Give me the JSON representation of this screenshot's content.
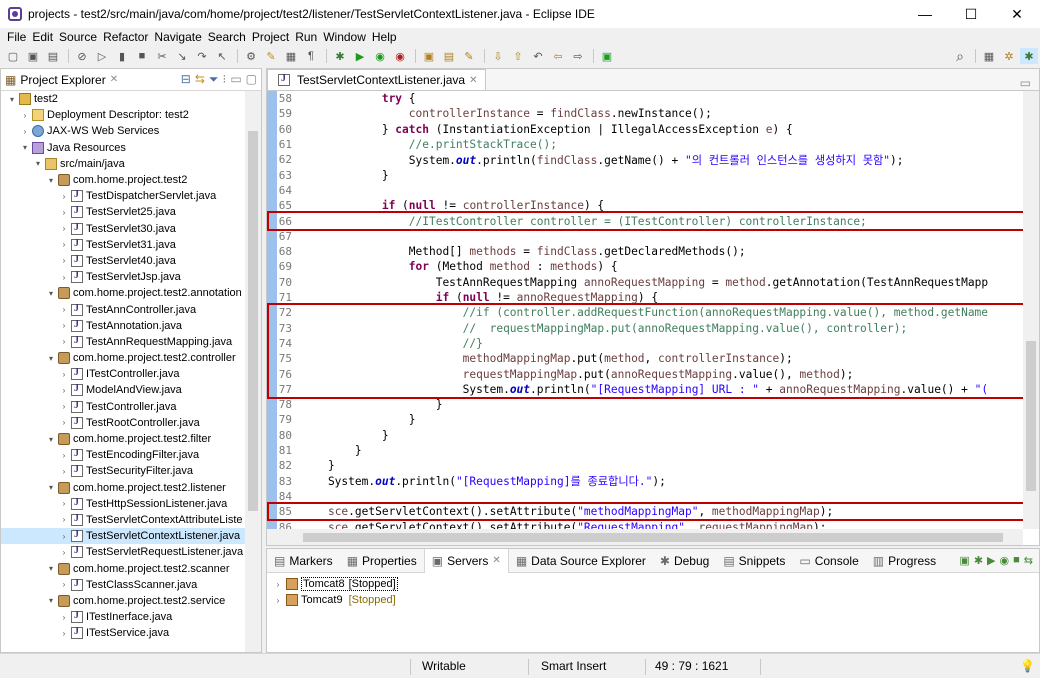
{
  "window": {
    "title": "projects - test2/src/main/java/com/home/project/test2/listener/TestServletContextListener.java - Eclipse IDE",
    "minimize": "—",
    "maximize": "☐",
    "close": "✕"
  },
  "menu": [
    "File",
    "Edit",
    "Source",
    "Refactor",
    "Navigate",
    "Search",
    "Project",
    "Run",
    "Window",
    "Help"
  ],
  "project_explorer": {
    "title": "Project Explorer",
    "items": [
      {
        "label": "test2",
        "icon": "project-icon",
        "indent": 0,
        "twisty": "▾"
      },
      {
        "label": "Deployment Descriptor: test2",
        "icon": "descriptor-icon",
        "indent": 1,
        "twisty": "›"
      },
      {
        "label": "JAX-WS Web Services",
        "icon": "webservice-icon",
        "indent": 1,
        "twisty": "›"
      },
      {
        "label": "Java Resources",
        "icon": "library-icon",
        "indent": 1,
        "twisty": "▾"
      },
      {
        "label": "src/main/java",
        "icon": "folder-icon",
        "indent": 2,
        "twisty": "▾"
      },
      {
        "label": "com.home.project.test2",
        "icon": "package-icon",
        "indent": 3,
        "twisty": "▾"
      },
      {
        "label": "TestDispatcherServlet.java",
        "icon": "java-file-icon",
        "indent": 4,
        "twisty": "›"
      },
      {
        "label": "TestServlet25.java",
        "icon": "java-file-icon",
        "indent": 4,
        "twisty": "›"
      },
      {
        "label": "TestServlet30.java",
        "icon": "java-file-icon",
        "indent": 4,
        "twisty": "›"
      },
      {
        "label": "TestServlet31.java",
        "icon": "java-file-icon",
        "indent": 4,
        "twisty": "›"
      },
      {
        "label": "TestServlet40.java",
        "icon": "java-file-icon",
        "indent": 4,
        "twisty": "›"
      },
      {
        "label": "TestServletJsp.java",
        "icon": "java-file-icon",
        "indent": 4,
        "twisty": "›"
      },
      {
        "label": "com.home.project.test2.annotation",
        "icon": "package-icon",
        "indent": 3,
        "twisty": "▾"
      },
      {
        "label": "TestAnnController.java",
        "icon": "java-file-icon",
        "indent": 4,
        "twisty": "›"
      },
      {
        "label": "TestAnnotation.java",
        "icon": "java-file-icon",
        "indent": 4,
        "twisty": "›"
      },
      {
        "label": "TestAnnRequestMapping.java",
        "icon": "java-file-icon",
        "indent": 4,
        "twisty": "›"
      },
      {
        "label": "com.home.project.test2.controller",
        "icon": "package-icon",
        "indent": 3,
        "twisty": "▾"
      },
      {
        "label": "ITestController.java",
        "icon": "java-file-icon",
        "indent": 4,
        "twisty": "›"
      },
      {
        "label": "ModelAndView.java",
        "icon": "java-file-icon",
        "indent": 4,
        "twisty": "›"
      },
      {
        "label": "TestController.java",
        "icon": "java-file-icon",
        "indent": 4,
        "twisty": "›"
      },
      {
        "label": "TestRootController.java",
        "icon": "java-file-icon",
        "indent": 4,
        "twisty": "›"
      },
      {
        "label": "com.home.project.test2.filter",
        "icon": "package-icon",
        "indent": 3,
        "twisty": "▾"
      },
      {
        "label": "TestEncodingFilter.java",
        "icon": "java-file-icon",
        "indent": 4,
        "twisty": "›"
      },
      {
        "label": "TestSecurityFilter.java",
        "icon": "java-file-icon",
        "indent": 4,
        "twisty": "›"
      },
      {
        "label": "com.home.project.test2.listener",
        "icon": "package-icon",
        "indent": 3,
        "twisty": "▾"
      },
      {
        "label": "TestHttpSessionListener.java",
        "icon": "java-file-icon",
        "indent": 4,
        "twisty": "›"
      },
      {
        "label": "TestServletContextAttributeListe",
        "icon": "java-file-icon",
        "indent": 4,
        "twisty": "›"
      },
      {
        "label": "TestServletContextListener.java",
        "icon": "java-file-icon",
        "indent": 4,
        "twisty": "›",
        "selected": true
      },
      {
        "label": "TestServletRequestListener.java",
        "icon": "java-file-icon",
        "indent": 4,
        "twisty": "›"
      },
      {
        "label": "com.home.project.test2.scanner",
        "icon": "package-icon",
        "indent": 3,
        "twisty": "▾"
      },
      {
        "label": "TestClassScanner.java",
        "icon": "java-file-icon",
        "indent": 4,
        "twisty": "›"
      },
      {
        "label": "com.home.project.test2.service",
        "icon": "package-icon",
        "indent": 3,
        "twisty": "▾"
      },
      {
        "label": "ITestInerface.java",
        "icon": "java-file-icon",
        "indent": 4,
        "twisty": "›"
      },
      {
        "label": "ITestService.java",
        "icon": "java-file-icon",
        "indent": 4,
        "twisty": "›"
      }
    ]
  },
  "editor": {
    "tab_label": "TestServletContextListener.java",
    "lines": [
      {
        "n": "58",
        "html": "            <span class=\"kw\">try</span> {"
      },
      {
        "n": "59",
        "html": "                <span class=\"var\">controllerInstance</span> = <span class=\"var\">findClass</span>.newInstance();"
      },
      {
        "n": "60",
        "html": "            } <span class=\"kw\">catch</span> (InstantiationException | IllegalAccessException <span class=\"var\">e</span>) {"
      },
      {
        "n": "61",
        "html": "                <span class=\"cm\">//e.printStackTrace();</span>"
      },
      {
        "n": "62",
        "html": "                System.<span class=\"st\">out</span>.println(<span class=\"var\">findClass</span>.getName() + <span class=\"str\">\"의 컨트롤러 인스턴스를 생성하지 못함\"</span>);"
      },
      {
        "n": "63",
        "html": "            }"
      },
      {
        "n": "64",
        "html": ""
      },
      {
        "n": "65",
        "html": "            <span class=\"kw\">if</span> (<span class=\"kw\">null</span> != <span class=\"var\">controllerInstance</span>) {"
      },
      {
        "n": "66",
        "html": "                <span class=\"cm\">//ITestController controller = (ITestController) controllerInstance;</span>"
      },
      {
        "n": "67",
        "html": ""
      },
      {
        "n": "68",
        "html": "                Method[] <span class=\"var\">methods</span> = <span class=\"var\">findClass</span>.getDeclaredMethods();"
      },
      {
        "n": "69",
        "html": "                <span class=\"kw\">for</span> (Method <span class=\"var\">method</span> : <span class=\"var\">methods</span>) {"
      },
      {
        "n": "70",
        "html": "                    TestAnnRequestMapping <span class=\"var\">annoRequestMapping</span> = <span class=\"var\">method</span>.getAnnotation(TestAnnRequestMapp"
      },
      {
        "n": "71",
        "html": "                    <span class=\"kw\">if</span> (<span class=\"kw\">null</span> != <span class=\"var\">annoRequestMapping</span>) {"
      },
      {
        "n": "72",
        "html": "                        <span class=\"cm\">//if (controller.addRequestFunction(annoRequestMapping.value(), method.getName</span>"
      },
      {
        "n": "73",
        "html": "                        <span class=\"cm\">//  requestMappingMap.put(annoRequestMapping.value(), controller);</span>"
      },
      {
        "n": "74",
        "html": "                        <span class=\"cm\">//}</span>"
      },
      {
        "n": "75",
        "html": "                        <span class=\"var\">methodMappingMap</span>.put(<span class=\"var\">method</span>, <span class=\"var\">controllerInstance</span>);"
      },
      {
        "n": "76",
        "html": "                        <span class=\"var\">requestMappingMap</span>.put(<span class=\"var\">annoRequestMapping</span>.value(), <span class=\"var\">method</span>);"
      },
      {
        "n": "77",
        "html": "                        System.<span class=\"st\">out</span>.println(<span class=\"str\">\"[RequestMapping] URL : \"</span> + <span class=\"var\">annoRequestMapping</span>.value() + <span class=\"str\">\"(</span>"
      },
      {
        "n": "78",
        "html": "                    }"
      },
      {
        "n": "79",
        "html": "                }"
      },
      {
        "n": "80",
        "html": "            }"
      },
      {
        "n": "81",
        "html": "        }"
      },
      {
        "n": "82",
        "html": "    }"
      },
      {
        "n": "83",
        "html": "    System.<span class=\"st\">out</span>.println(<span class=\"str\">\"[RequestMapping]를 종료합니다.\"</span>);"
      },
      {
        "n": "84",
        "html": ""
      },
      {
        "n": "85",
        "html": "    <span class=\"var\">sce</span>.getServletContext().setAttribute(<span class=\"str\">\"methodMappingMap\"</span>, <span class=\"var\">methodMappingMap</span>);"
      },
      {
        "n": "86",
        "html": "    <span class=\"var\">sce</span>.getServletContext().setAttribute(<span class=\"str\">\"RequestMapping\"</span>, <span class=\"var\">requestMappingMap</span>);"
      }
    ]
  },
  "bottom_panel": {
    "tabs": [
      "Markers",
      "Properties",
      "Servers",
      "Data Source Explorer",
      "Debug",
      "Snippets",
      "Console",
      "Progress"
    ],
    "active_tab": "Servers",
    "servers": [
      {
        "name": "Tomcat8",
        "status": "[Stopped]",
        "selected": true
      },
      {
        "name": "Tomcat9",
        "status": "[Stopped]",
        "selected": false
      }
    ]
  },
  "status_bar": {
    "mode": "Writable",
    "insert": "Smart Insert",
    "position": "49 : 79 : 1621"
  }
}
